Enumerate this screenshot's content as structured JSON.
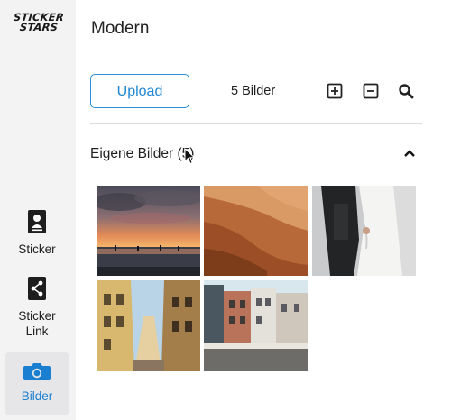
{
  "sidebar": {
    "logo": {
      "line1": "STICKER",
      "line2": "STARS"
    },
    "items": [
      {
        "label": "Sticker",
        "icon": "sticker-card-icon"
      },
      {
        "label_line1": "Sticker",
        "label_line2": "Link",
        "icon": "share-icon"
      },
      {
        "label": "Bilder",
        "icon": "camera-icon",
        "active": true
      }
    ]
  },
  "header": {
    "title": "Modern"
  },
  "toolbar": {
    "upload_label": "Upload",
    "count_label": "5 Bilder",
    "icons": [
      "plus-box-icon",
      "minus-box-icon",
      "search-icon"
    ]
  },
  "section": {
    "title": "Eigene Bilder (5)",
    "expanded": true
  },
  "images": [
    {
      "name": "sunset-beach"
    },
    {
      "name": "desert-dunes"
    },
    {
      "name": "wedding-couple"
    },
    {
      "name": "city-street"
    },
    {
      "name": "canal-houses"
    }
  ],
  "colors": {
    "accent": "#1f86d3",
    "sidebar_bg": "#f3f3f4",
    "active_bg": "#e6e6e8"
  }
}
